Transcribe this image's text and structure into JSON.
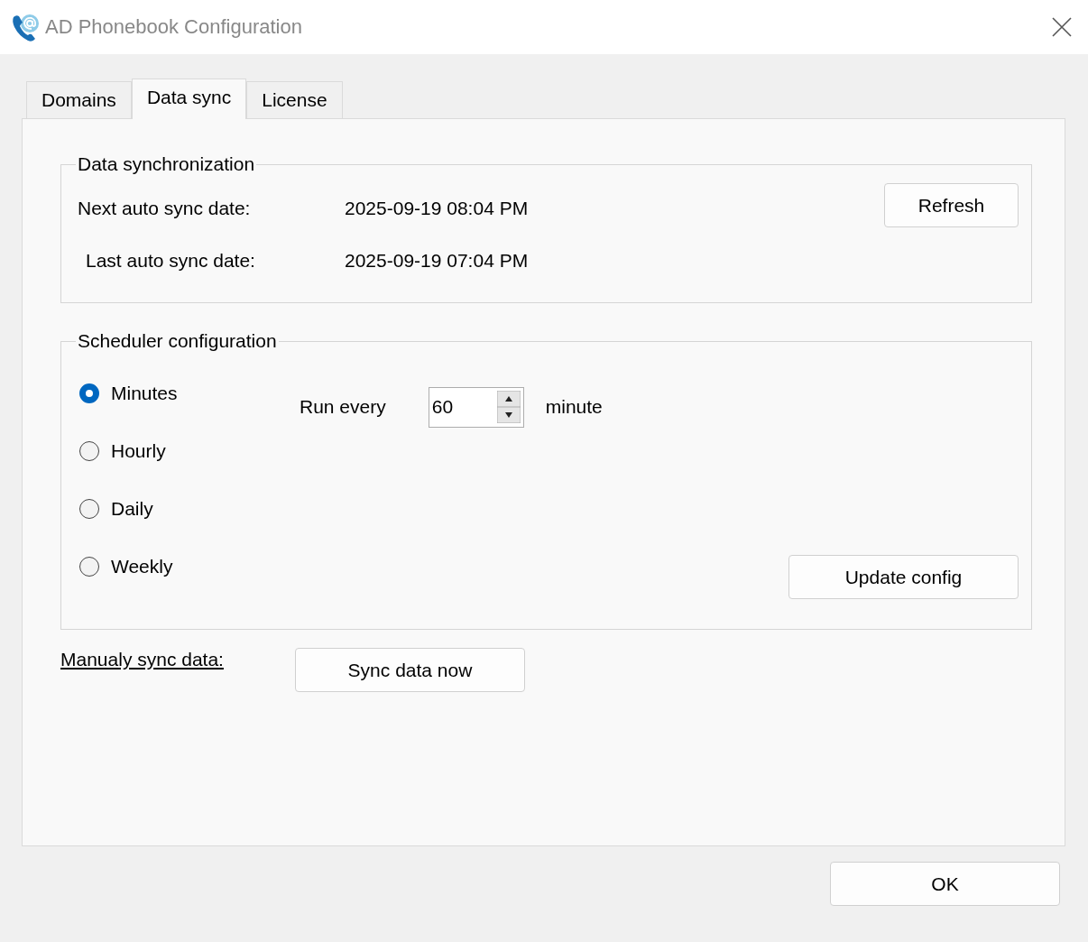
{
  "window": {
    "title": "AD Phonebook Configuration"
  },
  "tabs": [
    {
      "label": "Domains",
      "selected": false
    },
    {
      "label": "Data sync",
      "selected": true
    },
    {
      "label": "License",
      "selected": false
    }
  ],
  "sync_group": {
    "title": "Data synchronization",
    "rows": [
      {
        "label": "Next auto sync date:",
        "value": "2025-09-19 08:04 PM"
      },
      {
        "label": "Last auto sync date:",
        "value": "2025-09-19 07:04 PM"
      }
    ],
    "refresh_button": "Refresh"
  },
  "scheduler_group": {
    "title": "Scheduler configuration",
    "options": [
      {
        "label": "Minutes",
        "selected": true
      },
      {
        "label": "Hourly",
        "selected": false
      },
      {
        "label": "Daily",
        "selected": false
      },
      {
        "label": "Weekly",
        "selected": false
      }
    ],
    "run_every_label": "Run every",
    "interval": "60",
    "unit": "minute",
    "update_button": "Update config"
  },
  "manual_sync": {
    "label": "Manualy sync data:",
    "button": "Sync data now"
  },
  "ok_button": "OK"
}
